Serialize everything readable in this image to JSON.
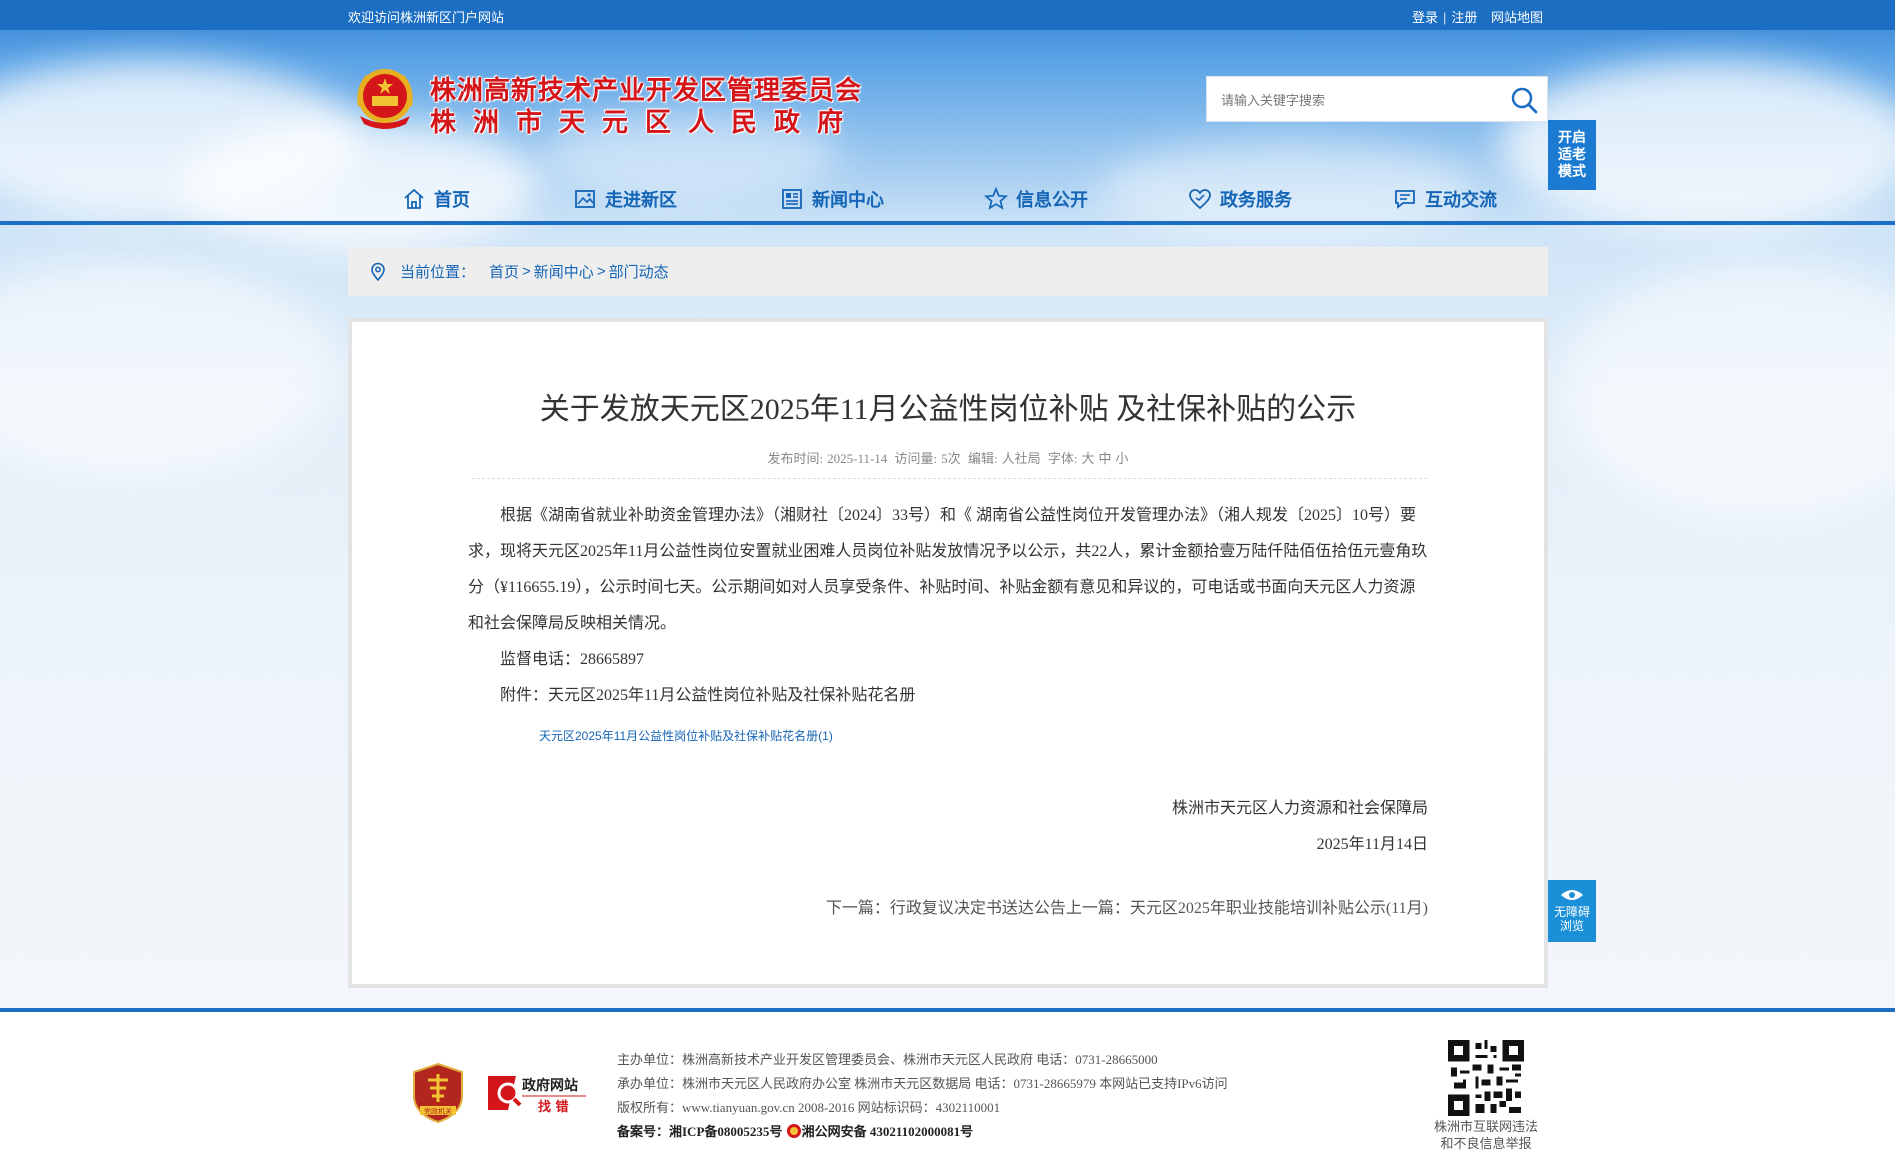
{
  "topbar": {
    "welcome": "欢迎访问株洲新区门户网站",
    "login": "登录",
    "register": "注册",
    "sitemap": "网站地图"
  },
  "header": {
    "logo_line1": "株洲高新技术产业开发区管理委员会",
    "logo_line2": "株洲市天元区人民政府",
    "search_placeholder": "请输入关键字搜索",
    "elder_mode": [
      "开启",
      "适老",
      "模式"
    ]
  },
  "nav": {
    "items": [
      {
        "label": "首页",
        "icon": "home-icon"
      },
      {
        "label": "走进新区",
        "icon": "picture-icon"
      },
      {
        "label": "新闻中心",
        "icon": "news-icon"
      },
      {
        "label": "信息公开",
        "icon": "star-icon"
      },
      {
        "label": "政务服务",
        "icon": "heart-icon"
      },
      {
        "label": "互动交流",
        "icon": "chat-icon"
      }
    ]
  },
  "breadcrumb": {
    "label": "当前位置：",
    "items": [
      "首页",
      "新闻中心",
      "部门动态"
    ]
  },
  "article": {
    "title": "关于发放天元区2025年11月公益性岗位补贴 及社保补贴的公示",
    "meta": {
      "publish_label": "发布时间:",
      "publish_date": "2025-11-14",
      "views_label": "访问量:",
      "views": "5次",
      "editor_label": "编辑:",
      "editor": "人社局",
      "font_label": "字体:",
      "font_large": "大",
      "font_medium": "中",
      "font_small": "小"
    },
    "paragraph1": "根据《湖南省就业补助资金管理办法》（湘财社〔2024〕33号）和《 湖南省公益性岗位开发管理办法》（湘人规发〔2025〕10号）要求，现将天元区2025年11月公益性岗位安置就业困难人员岗位补贴发放情况予以公示，共22人，累计金额拾壹万陆仟陆佰伍拾伍元壹角玖分（¥116655.19），公示时间七天。公示期间如对人员享受条件、补贴时间、补贴金额有意见和异议的，可电话或书面向天元区人力资源和社会保障局反映相关情况。",
    "phone_line": "监督电话：28665897",
    "attachment_line": "附件：天元区2025年11月公益性岗位补贴及社保补贴花名册",
    "attachment_link": "天元区2025年11月公益性岗位补贴及社保补贴花名册(1)",
    "sign_org": "株洲市天元区人力资源和社会保障局",
    "sign_date": "2025年11月14日",
    "next_label": "下一篇：",
    "next_title": "行政复议决定书送达公告",
    "prev_label": "上一篇：",
    "prev_title": "天元区2025年职业技能培训补贴公示(11月)"
  },
  "accessibility": {
    "line1": "无障碍",
    "line2": "浏览"
  },
  "footer": {
    "badge_jz": "党政机关",
    "badge_zf_line1": "政府网站",
    "badge_zf_line2": "找 错",
    "line1": "主办单位：株洲高新技术产业开发区管理委员会、株洲市天元区人民政府 电话：0731-28665000",
    "line2": "承办单位：株洲市天元区人民政府办公室 株洲市天元区数据局 电话：0731-28665979 本网站已支持IPv6访问",
    "line3": "版权所有：www.tianyuan.gov.cn 2008-2016 网站标识码：4302110001",
    "icp": "备案号：湘ICP备08005235号",
    "police": "湘公网安备 43021102000081号",
    "qr_caption_line1": "株洲市互联网违法",
    "qr_caption_line2": "和不良信息举报"
  },
  "colors": {
    "brand_blue": "#1b6ec2",
    "logo_red": "#d4161b",
    "link_blue": "#1565b7"
  }
}
